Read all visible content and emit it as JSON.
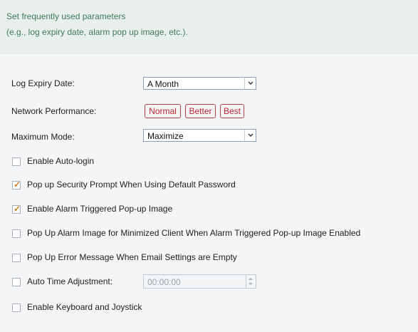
{
  "header": {
    "line1": "Set frequently used parameters",
    "line2": "(e.g., log expiry date, alarm pop up image, etc.)."
  },
  "log_expiry": {
    "label": "Log Expiry Date:",
    "value": "A Month"
  },
  "network_performance": {
    "label": "Network Performance:",
    "options": [
      "Normal",
      "Better",
      "Best"
    ]
  },
  "maximum_mode": {
    "label": "Maximum Mode:",
    "value": "Maximize"
  },
  "checkboxes": [
    {
      "label": "Enable Auto-login",
      "checked": false
    },
    {
      "label": "Pop up Security Prompt When Using Default Password",
      "checked": true
    },
    {
      "label": "Enable Alarm Triggered Pop-up Image",
      "checked": true
    },
    {
      "label": "Pop Up Alarm Image for Minimized Client When Alarm Triggered Pop-up Image Enabled",
      "checked": false
    },
    {
      "label": "Pop Up Error Message When Email Settings are Empty",
      "checked": false
    },
    {
      "label": "Auto Time Adjustment:",
      "checked": false
    },
    {
      "label": "Enable Keyboard and Joystick",
      "checked": false
    }
  ],
  "auto_time": {
    "value": "00:00:00"
  },
  "icons": {
    "dropdown": "chevron-down-icon",
    "check": "checkmark-icon",
    "spinner": "spinner-arrows-icon"
  },
  "colors": {
    "header_bg": "#e8efec",
    "header_text": "#3f7a5a",
    "accent_red": "#b02a34",
    "check_orange": "#d07a1c"
  }
}
